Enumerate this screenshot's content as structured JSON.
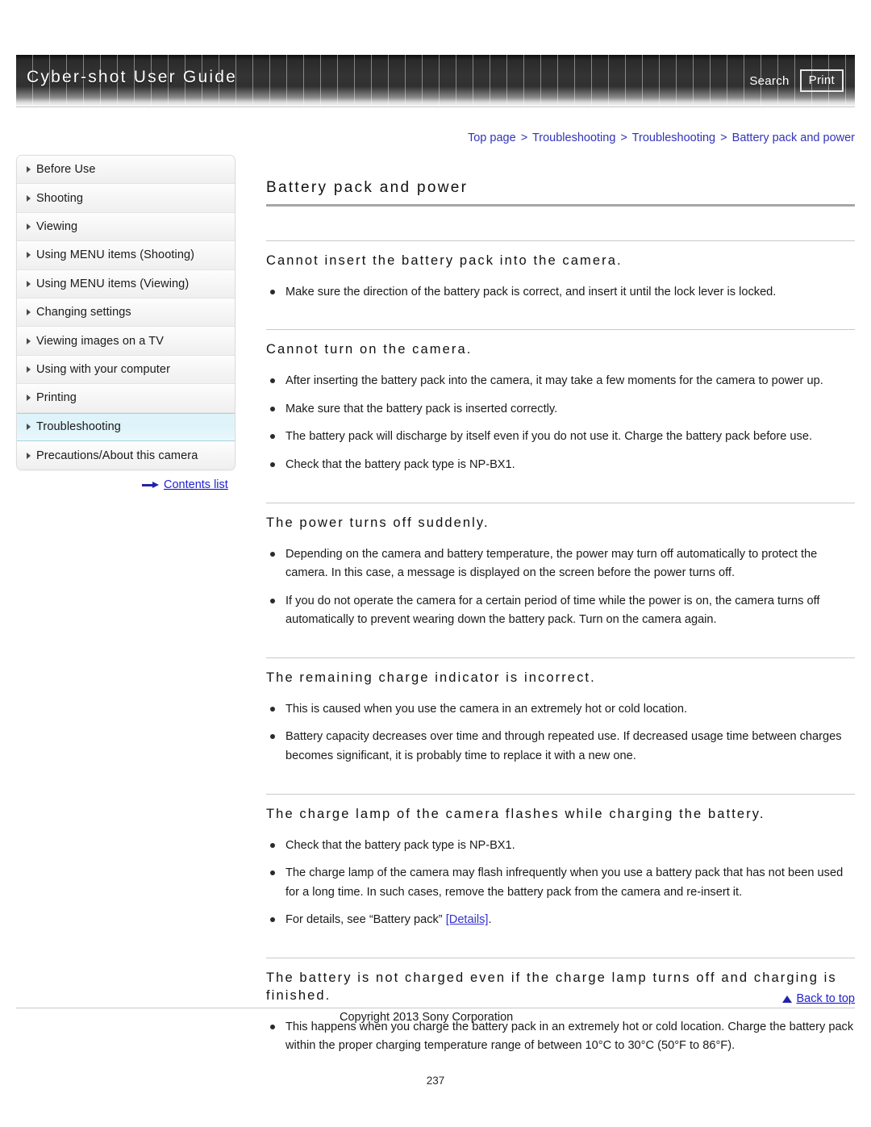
{
  "header": {
    "title": "Cyber-shot User Guide",
    "search_label": "Search",
    "print_label": "Print"
  },
  "breadcrumb": {
    "items": [
      "Top page",
      "Troubleshooting",
      "Troubleshooting",
      "Battery pack and power"
    ],
    "separator": ">"
  },
  "sidebar": {
    "items": [
      {
        "label": "Before Use",
        "active": false
      },
      {
        "label": "Shooting",
        "active": false
      },
      {
        "label": "Viewing",
        "active": false
      },
      {
        "label": "Using MENU items (Shooting)",
        "active": false
      },
      {
        "label": "Using MENU items (Viewing)",
        "active": false
      },
      {
        "label": "Changing settings",
        "active": false
      },
      {
        "label": "Viewing images on a TV",
        "active": false
      },
      {
        "label": "Using with your computer",
        "active": false
      },
      {
        "label": "Printing",
        "active": false
      },
      {
        "label": "Troubleshooting",
        "active": true
      },
      {
        "label": "Precautions/About this camera",
        "active": false
      }
    ],
    "contents_link": "Contents list"
  },
  "main": {
    "page_title": "Battery pack and power",
    "sections": [
      {
        "heading": "Cannot insert the battery pack into the camera.",
        "bullets": [
          "Make sure the direction of the battery pack is correct, and insert it until the lock lever is locked."
        ]
      },
      {
        "heading": "Cannot turn on the camera.",
        "bullets": [
          "After inserting the battery pack into the camera, it may take a few moments for the camera to power up.",
          "Make sure that the battery pack is inserted correctly.",
          "The battery pack will discharge by itself even if you do not use it. Charge the battery pack before use.",
          "Check that the battery pack type is NP-BX1."
        ]
      },
      {
        "heading": "The power turns off suddenly.",
        "bullets": [
          "Depending on the camera and battery temperature, the power may turn off automatically to protect the camera. In this case, a message is displayed on the screen before the power turns off.",
          "If you do not operate the camera for a certain period of time while the power is on, the camera turns off automatically to prevent wearing down the battery pack. Turn on the camera again."
        ]
      },
      {
        "heading": "The remaining charge indicator is incorrect.",
        "bullets": [
          "This is caused when you use the camera in an extremely hot or cold location.",
          "Battery capacity decreases over time and through repeated use. If decreased usage time between charges becomes significant, it is probably time to replace it with a new one."
        ]
      },
      {
        "heading": "The charge lamp of the camera flashes while charging the battery.",
        "bullets": [
          "Check that the battery pack type is NP-BX1.",
          "The charge lamp of the camera may flash infrequently when you use a battery pack that has not been used for a long time. In such cases, remove the battery pack from the camera and re-insert it."
        ],
        "bullet_with_link": {
          "before": "For details, see “Battery pack” ",
          "link": "[Details]",
          "after": "."
        }
      },
      {
        "heading": "The battery is not charged even if the charge lamp turns off and charging is finished.",
        "bullets": [
          "This happens when you charge the battery pack in an extremely hot or cold location. Charge the battery pack within the proper charging temperature range of between 10°C to 30°C (50°F to 86°F)."
        ]
      }
    ]
  },
  "footer": {
    "back_to_top": "Back to top",
    "copyright": "Copyright 2013 Sony Corporation",
    "page_number": "237"
  },
  "colors": {
    "link": "#2222cc",
    "breadcrumb": "#3333bb",
    "active_nav": "#ddf3fa"
  }
}
